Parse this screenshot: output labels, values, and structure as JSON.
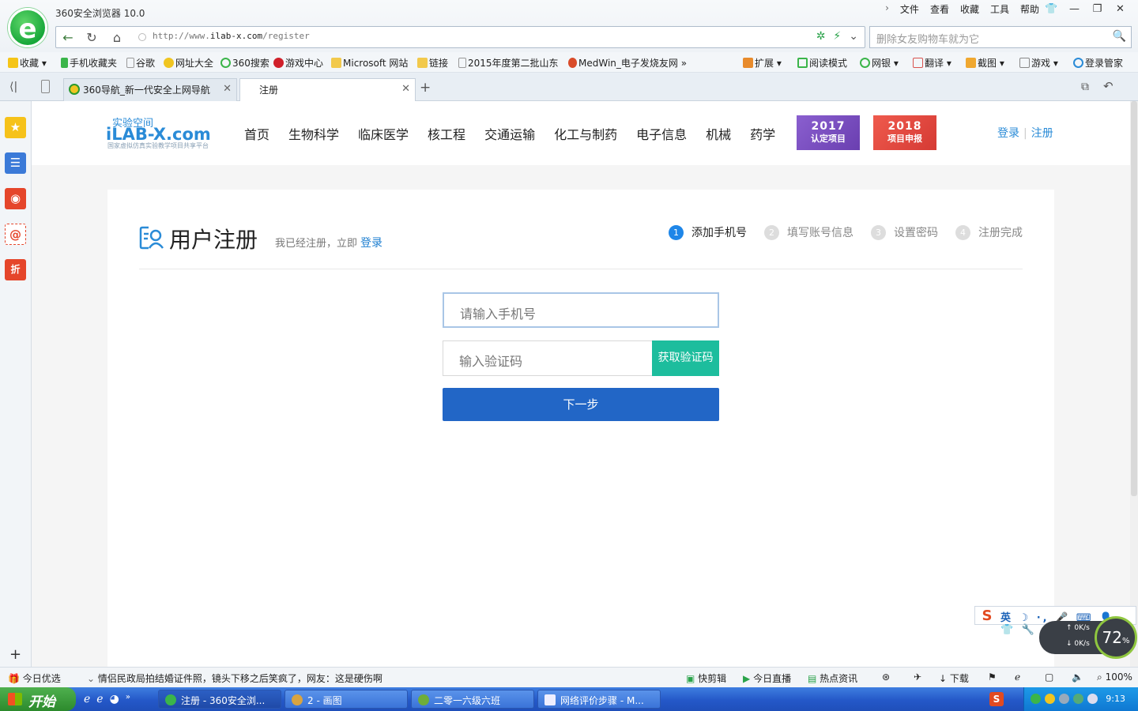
{
  "browser": {
    "app_title": "360安全浏览器 10.0",
    "menu": [
      "文件",
      "查看",
      "收藏",
      "工具",
      "帮助"
    ],
    "url_prefix": "http://www.",
    "url_domain": "ilab-x.com",
    "url_path": "/register",
    "search_placeholder": "删除女友购物车就为它",
    "bookmarks": [
      "收藏",
      "手机收藏夹",
      "谷歌",
      "网址大全",
      "360搜索",
      "游戏中心",
      "Microsoft 网站",
      "链接",
      "2015年度第二批山东",
      "MedWin_电子发烧友网"
    ],
    "tools": [
      "扩展",
      "阅读模式",
      "网银",
      "翻译",
      "截图",
      "游戏",
      "登录管家"
    ],
    "tabs": [
      {
        "label": "360导航_新一代安全上网导航"
      },
      {
        "label": "注册"
      }
    ]
  },
  "site": {
    "logo_cn": "实验空间",
    "logo_en": "iLAB-X.com",
    "logo_sub": "国家虚拟仿真实验教学项目共享平台",
    "nav": [
      "首页",
      "生物科学",
      "临床医学",
      "核工程",
      "交通运输",
      "化工与制药",
      "电子信息",
      "机械",
      "药学"
    ],
    "banner_2017": {
      "year": "2017",
      "title": "认定项目",
      "color": "#7a4fbf"
    },
    "banner_2018": {
      "year": "2018",
      "title": "项目申报",
      "color": "#e2473f"
    },
    "login": "登录",
    "register": "注册"
  },
  "register": {
    "title": "用户注册",
    "hint": "我已经注册，立即",
    "hint_link": "登录",
    "steps": [
      {
        "num": "1",
        "label": "添加手机号",
        "active": true
      },
      {
        "num": "2",
        "label": "填写账号信息",
        "active": false
      },
      {
        "num": "3",
        "label": "设置密码",
        "active": false
      },
      {
        "num": "4",
        "label": "注册完成",
        "active": false
      }
    ],
    "phone_placeholder": "请输入手机号",
    "code_placeholder": "输入验证码",
    "get_code": "获取验证码",
    "next": "下一步"
  },
  "widgets": {
    "ime_lang": "英",
    "net_up": "0K/s",
    "net_down": "0K/s",
    "cpu": "72",
    "cpu_unit": "%"
  },
  "status": {
    "today": "今日优选",
    "news": "情侣民政局拍结婚证件照，镜头下移之后笑疯了，网友：这是硬伤啊",
    "items": [
      "快剪辑",
      "今日直播",
      "热点资讯",
      "下载"
    ],
    "zoom": "100%"
  },
  "taskbar": {
    "start": "开始",
    "tasks": [
      "注册 - 360安全浏...",
      "2 - 画图",
      "二零一六级六班",
      "网络评价步骤 - M..."
    ],
    "clock": "9:13"
  }
}
